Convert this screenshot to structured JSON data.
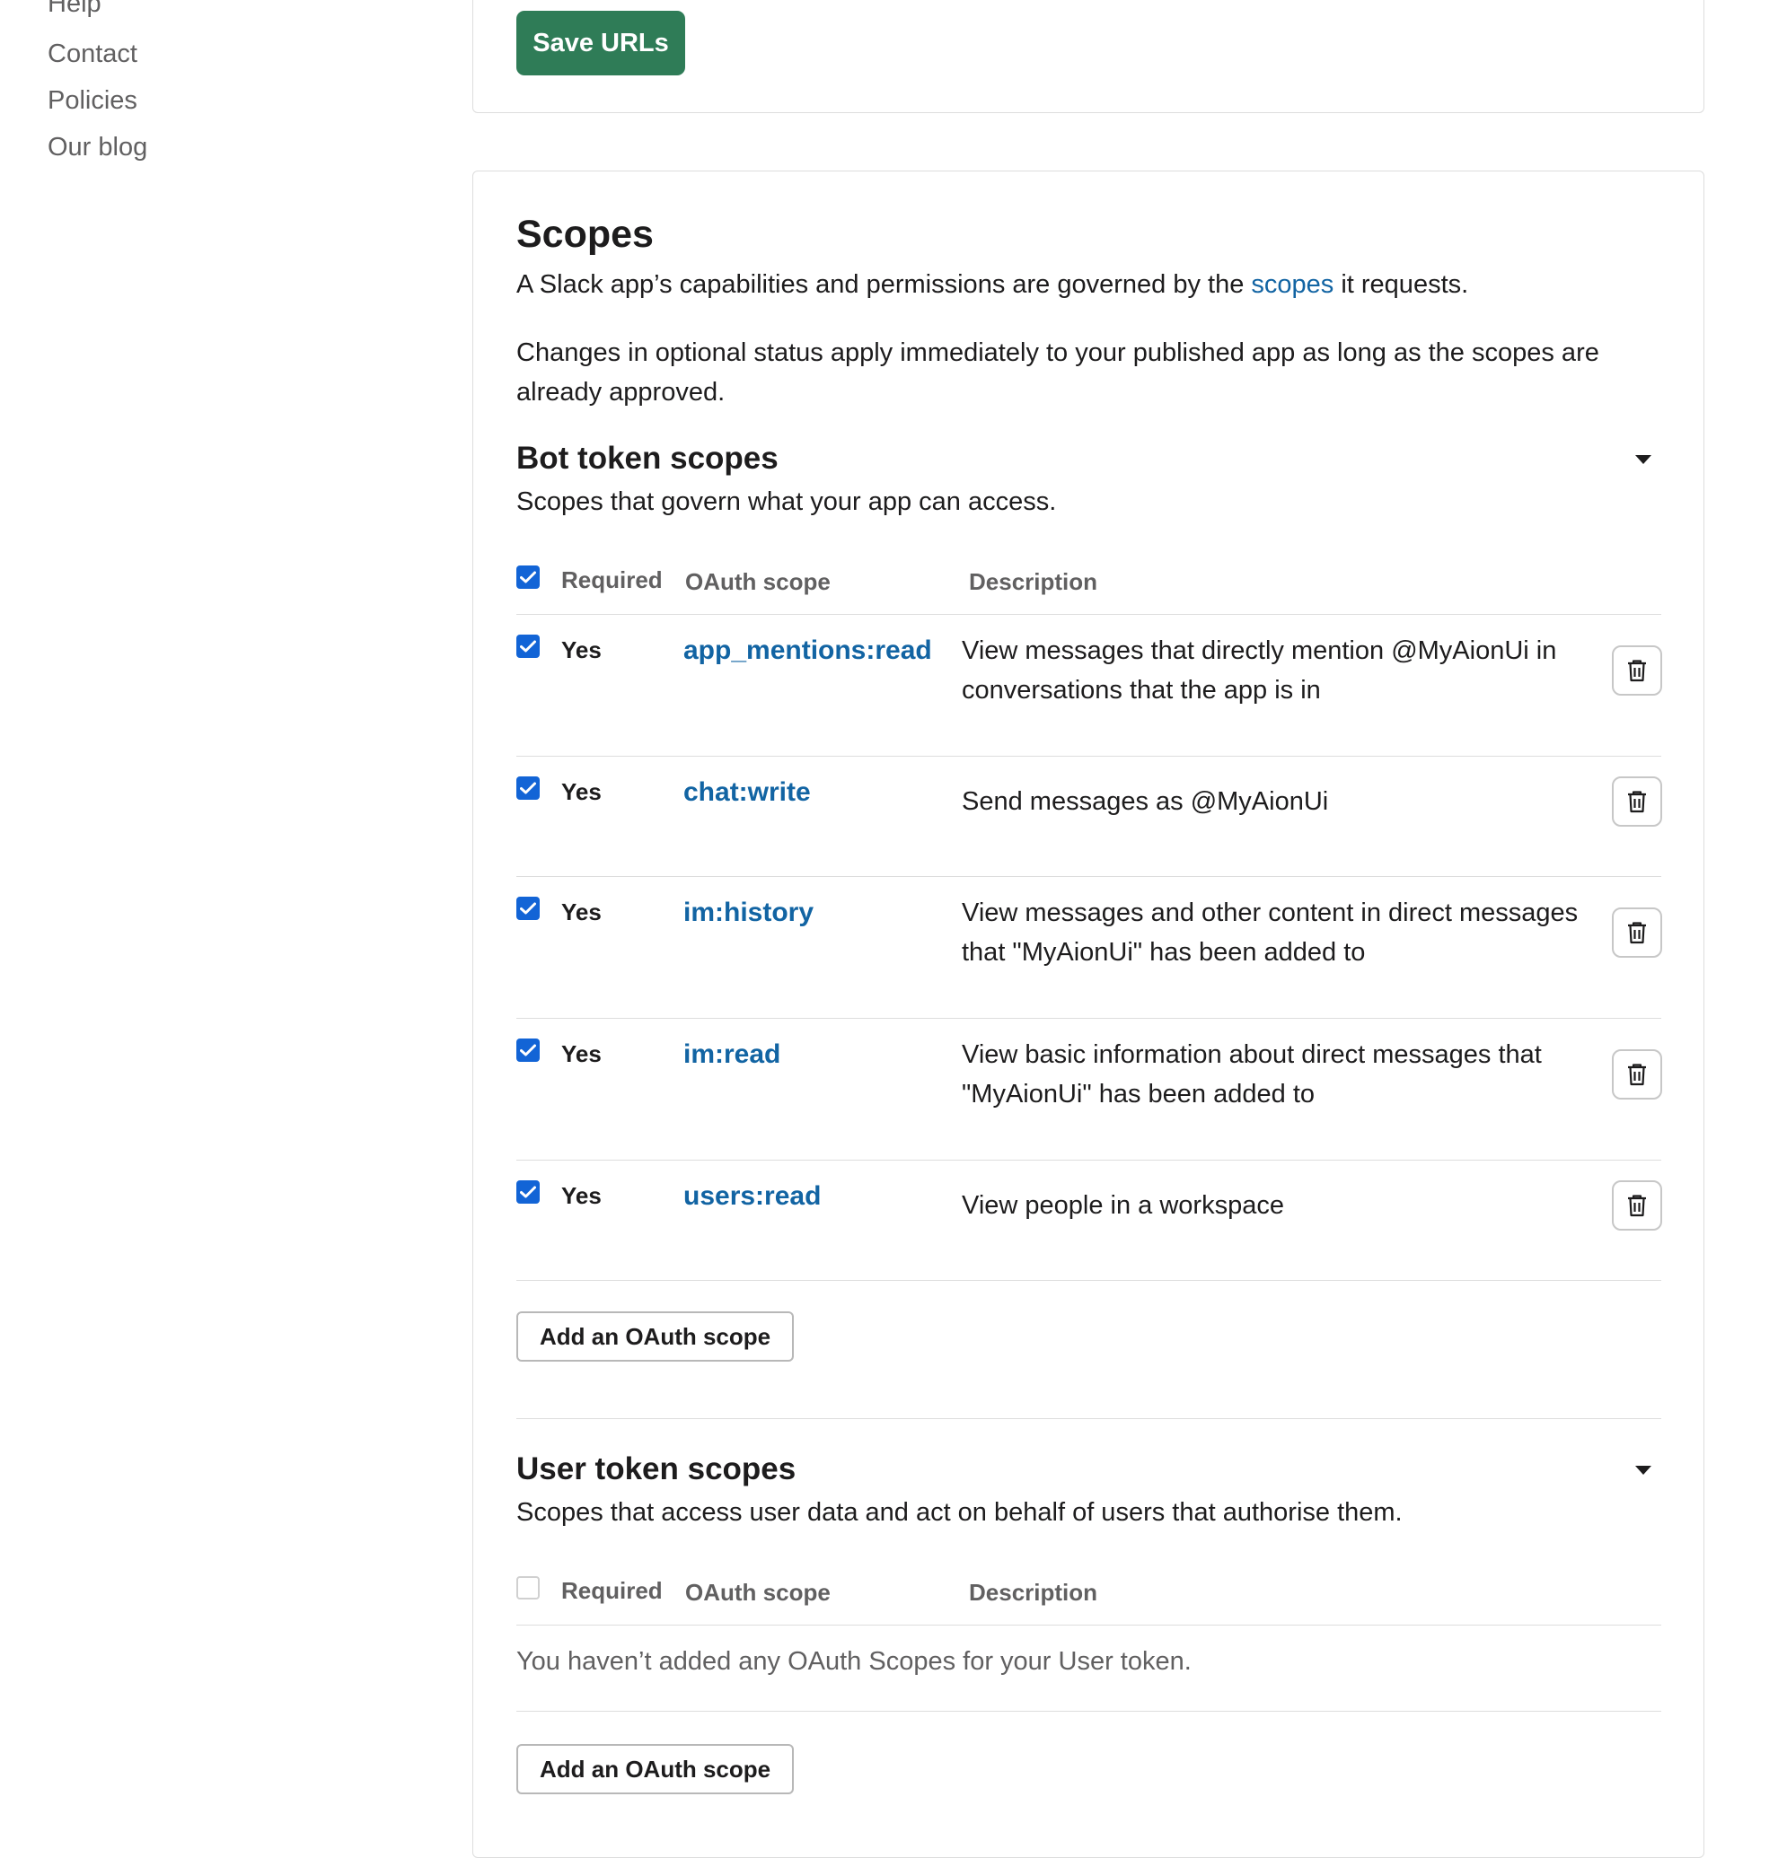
{
  "sidebar": {
    "links": [
      "Help",
      "Contact",
      "Policies",
      "Our blog"
    ]
  },
  "top_card": {
    "save_button": "Save URLs"
  },
  "scopes": {
    "title": "Scopes",
    "intro_before": "A Slack app’s capabilities and permissions are governed by the ",
    "intro_link": "scopes",
    "intro_after": " it requests.",
    "optional_note": "Changes in optional status apply immediately to your published app as long as the scopes are already approved.",
    "bot": {
      "title": "Bot token scopes",
      "subtitle": "Scopes that govern what your app can access.",
      "columns": {
        "required": "Required",
        "scope": "OAuth scope",
        "description": "Description"
      },
      "header_checked": true,
      "rows": [
        {
          "required": "Yes",
          "scope": "app_mentions:read",
          "description": "View messages that directly mention @MyAionUi in conversations that the app is in"
        },
        {
          "required": "Yes",
          "scope": "chat:write",
          "description": "Send messages as @MyAionUi"
        },
        {
          "required": "Yes",
          "scope": "im:history",
          "description": "View messages and other content in direct messages that \"MyAionUi\" has been added to"
        },
        {
          "required": "Yes",
          "scope": "im:read",
          "description": "View basic information about direct messages that \"MyAionUi\" has been added to"
        },
        {
          "required": "Yes",
          "scope": "users:read",
          "description": "View people in a workspace"
        }
      ],
      "add_button": "Add an OAuth scope"
    },
    "user": {
      "title": "User token scopes",
      "subtitle": "Scopes that access user data and act on behalf of users that authorise them.",
      "columns": {
        "required": "Required",
        "scope": "OAuth scope",
        "description": "Description"
      },
      "header_checked": false,
      "empty_message": "You haven’t added any OAuth Scopes for your User token.",
      "add_button": "Add an OAuth scope"
    }
  },
  "icons": {
    "checkbox": "checkmark-icon",
    "delete": "trash-icon",
    "collapse": "caret-down-icon"
  },
  "colors": {
    "primary_button": "#2f7c57",
    "link": "#1264a3",
    "checkbox": "#1264d6"
  }
}
